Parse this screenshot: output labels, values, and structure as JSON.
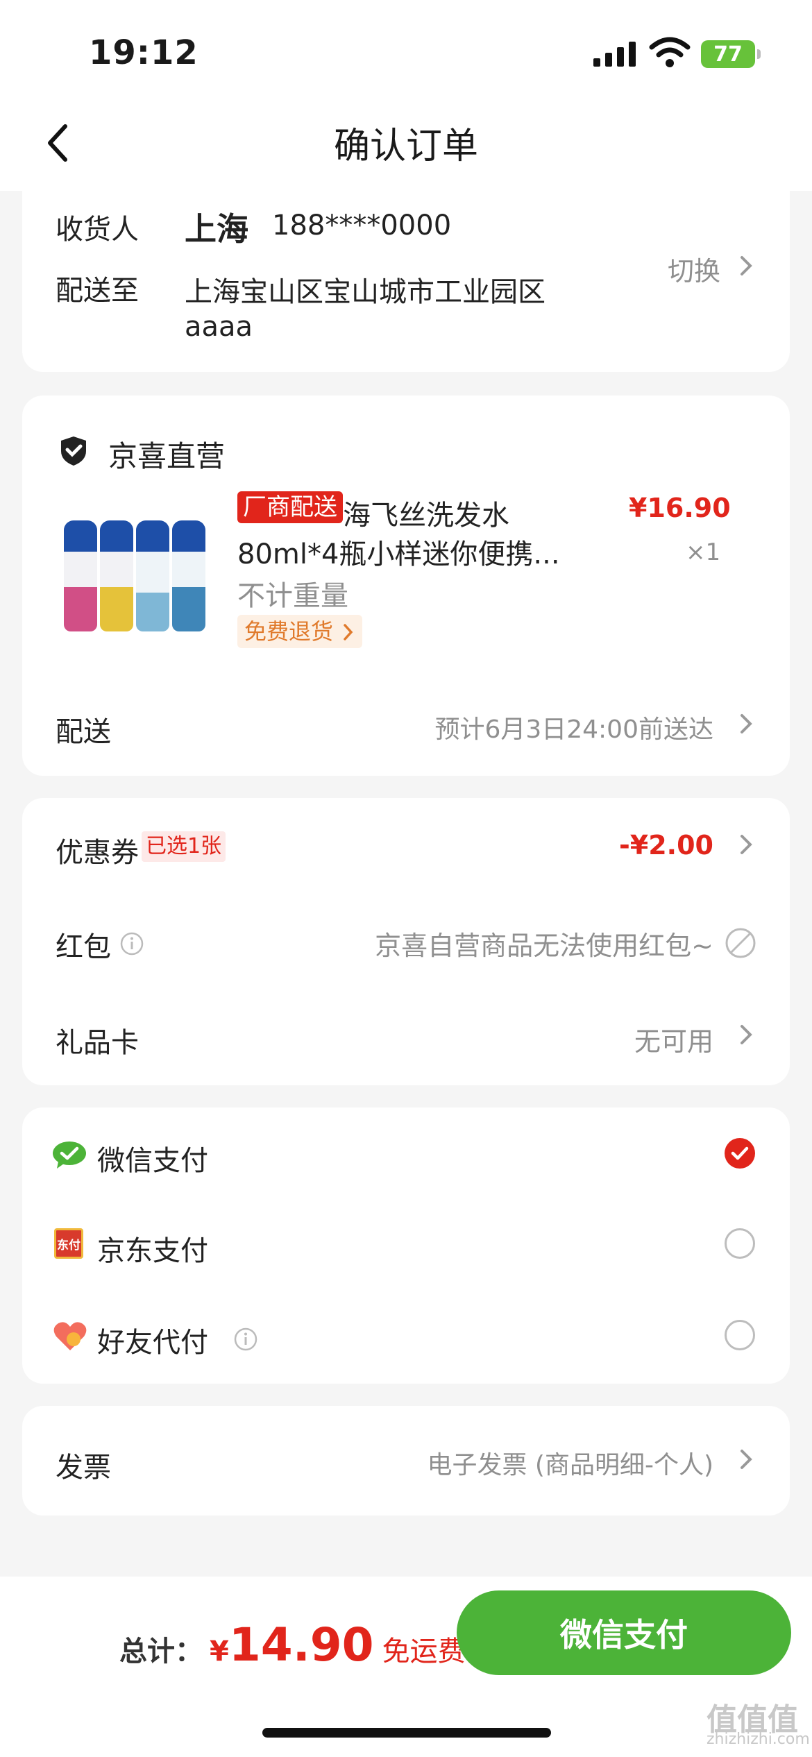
{
  "status": {
    "time": "19:12",
    "battery": "77"
  },
  "nav": {
    "title": "确认订单"
  },
  "address": {
    "receiver_label": "收货人",
    "receiver_name": "上海",
    "phone": "188****0000",
    "deliver_to_label": "配送至",
    "address_line1": "上海宝山区宝山城市工业园区",
    "address_line2": "aaaa",
    "switch_label": "切换"
  },
  "shop": {
    "name": "京喜直营",
    "product": {
      "tag": "厂商配送",
      "title_line1": "海飞丝洗发水",
      "title_line2": "80ml*4瓶小样迷你便携...",
      "price": "¥16.90",
      "qty": "×1",
      "weight": "不计重量",
      "return_badge": "免费退货"
    },
    "delivery_label": "配送",
    "delivery_value": "预计6月3日24:00前送达"
  },
  "discounts": {
    "coupon_label": "优惠券",
    "coupon_badge": "已选1张",
    "coupon_value": "-¥2.00",
    "redpacket_label": "红包",
    "redpacket_value": "京喜自营商品无法使用红包~",
    "giftcard_label": "礼品卡",
    "giftcard_value": "无可用"
  },
  "payment": {
    "wechat": "微信支付",
    "jd": "京东支付",
    "jd_icon_text": "东付",
    "friend": "好友代付"
  },
  "invoice": {
    "label": "发票",
    "value": "电子发票 (商品明细-个人)"
  },
  "footer": {
    "total_label": "总计：",
    "currency": "¥",
    "total_amount": "14.90",
    "free_shipping": "免运费",
    "pay_button": "微信支付"
  },
  "watermark": {
    "main": "值值值",
    "sub": "zhizhizhi.com"
  },
  "colors": {
    "accent": "#e1251b",
    "wechat_green": "#4cb338"
  }
}
